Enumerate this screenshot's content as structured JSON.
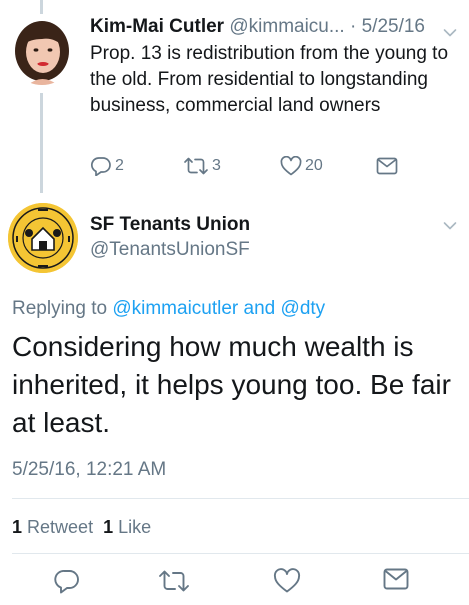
{
  "parent_tweet": {
    "author_name": "Kim-Mai Cutler",
    "author_handle": "@kimmaicu...",
    "date": "· 5/25/16",
    "text": "Prop. 13 is redistribution from the young to the old. From residential to longstanding business, commercial land owners",
    "replies": "2",
    "retweets": "3",
    "likes": "20"
  },
  "focused_tweet": {
    "author_name": "SF Tenants Union",
    "author_handle": "@TenantsUnionSF",
    "replying_prefix": "Replying to",
    "replying_user_1": "@kimmaicutler",
    "replying_and": "and",
    "replying_user_2": "@dty",
    "text": "Considering how much wealth is inherited, it helps young too. Be fair at least.",
    "timestamp": "5/25/16, 12:21 AM",
    "retweet_count": "1",
    "retweet_label": "Retweet",
    "like_count": "1",
    "like_label": "Like"
  },
  "colors": {
    "link": "#1da1f2",
    "secondary": "#657786",
    "primary": "#14171a",
    "divider": "#e1e8ed"
  },
  "icons": [
    "reply-icon",
    "retweet-icon",
    "like-icon",
    "message-icon",
    "chevron-down-icon"
  ]
}
